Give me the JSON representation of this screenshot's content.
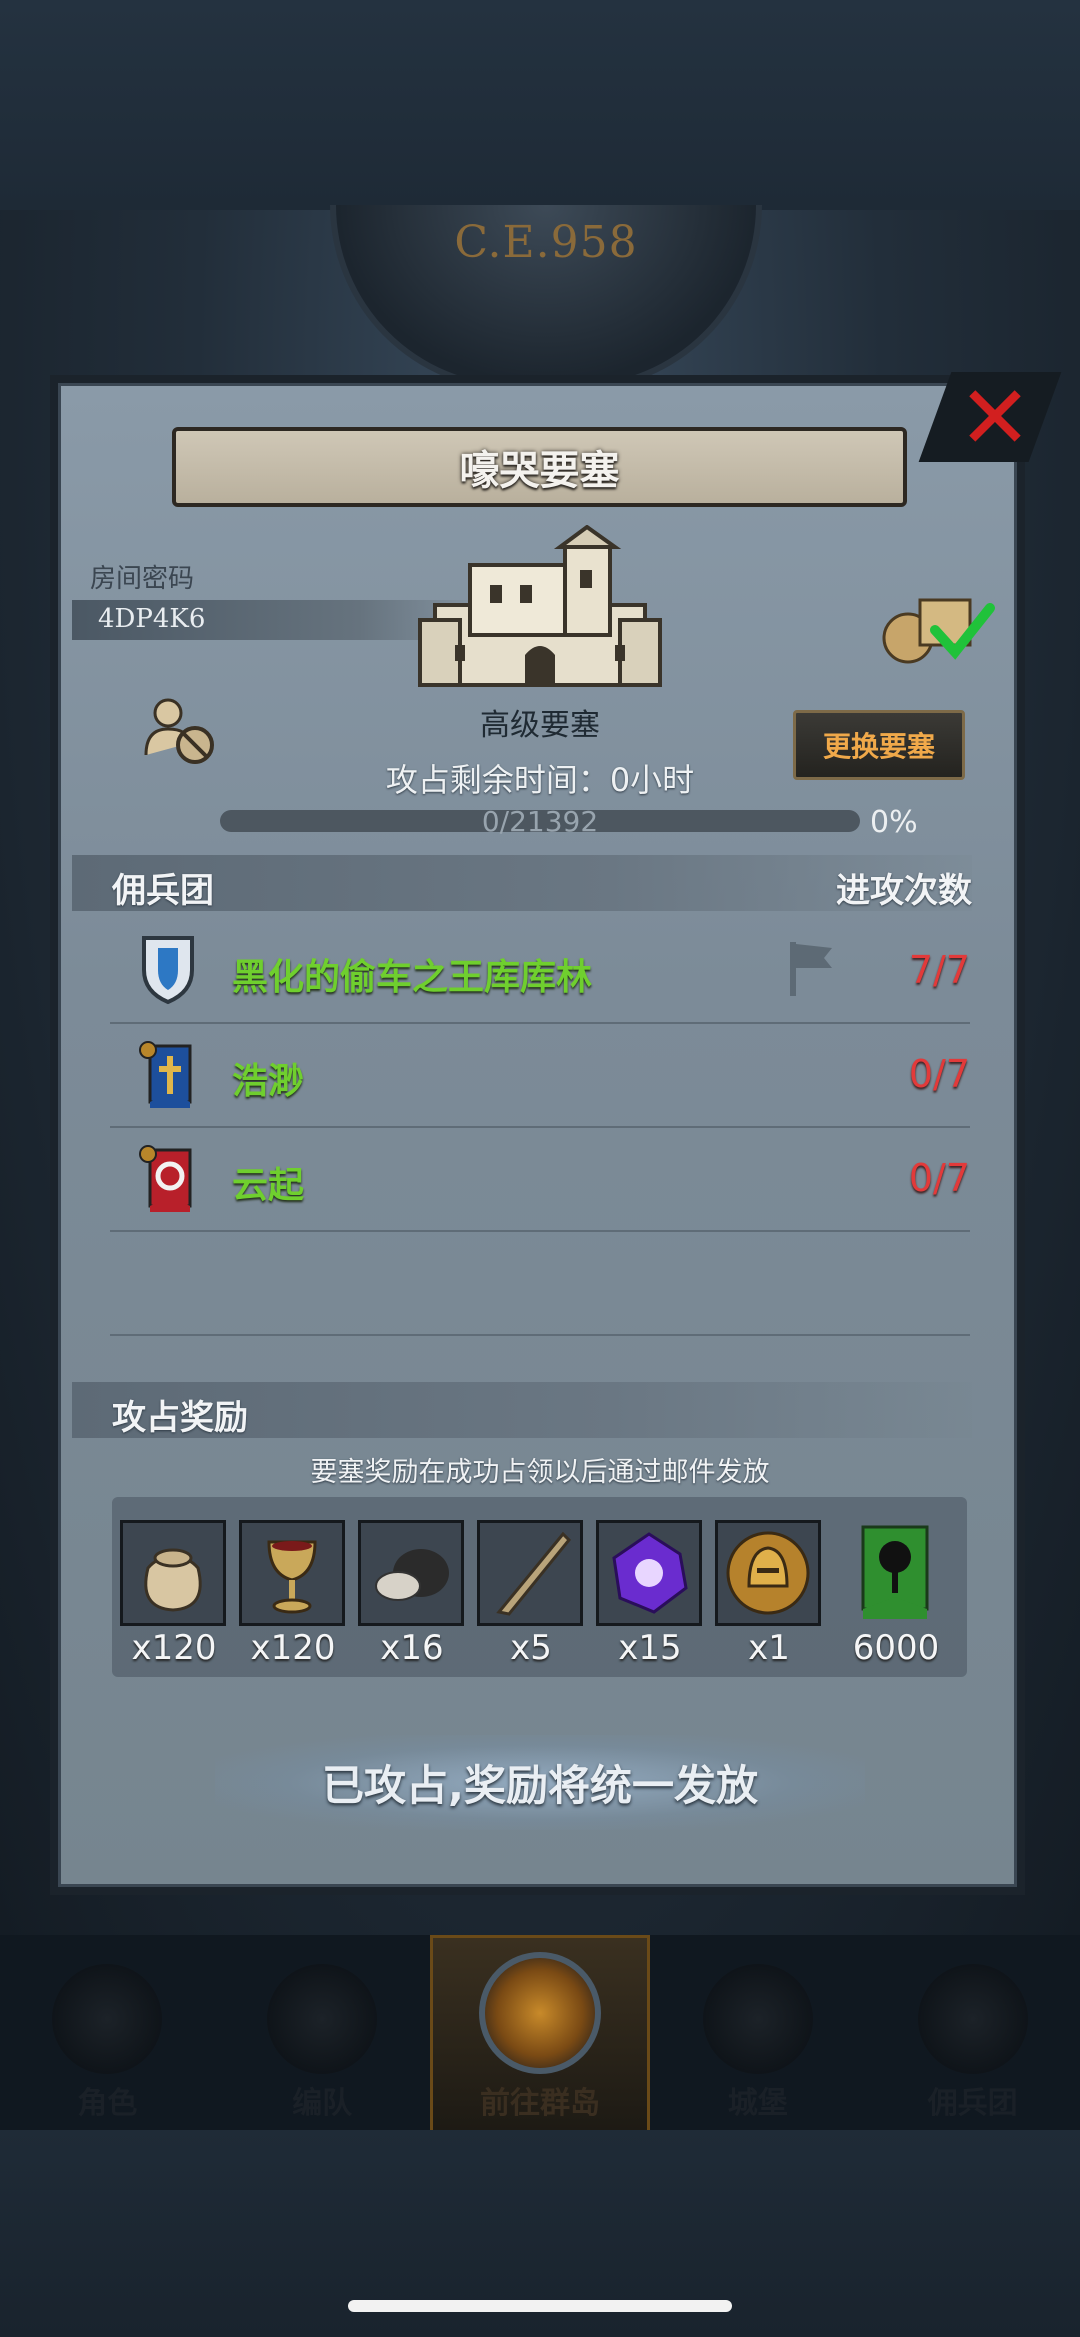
{
  "background": {
    "year_dial_text": "C.E.958"
  },
  "dialog": {
    "title": "嚎哭要塞",
    "room_label": "房间密码",
    "room_code": "4DP4K6",
    "fortress_name": "高级要塞",
    "time_left": "攻占剩余时间：0小时",
    "switch_button": "更换要塞",
    "progress": {
      "text": "0/21392",
      "percent_label": "0%",
      "fraction": 0
    },
    "mercenaries": {
      "header_left": "佣兵团",
      "header_right": "进攻次数",
      "rows": [
        {
          "name": "黑化的偷车之王库库林",
          "count": "7/7",
          "icon": "shield-emblem-icon",
          "flag": true
        },
        {
          "name": "浩渺",
          "count": "0/7",
          "icon": "blue-cross-banner-icon",
          "flag": false
        },
        {
          "name": "云起",
          "count": "0/7",
          "icon": "red-banner-icon",
          "flag": false
        }
      ]
    },
    "rewards": {
      "header": "攻占奖励",
      "note": "要塞奖励在成功占领以后通过邮件发放",
      "items": [
        {
          "icon": "coin-sack-icon",
          "qty": "x120"
        },
        {
          "icon": "wine-goblet-icon",
          "qty": "x120"
        },
        {
          "icon": "ore-chunk-icon",
          "qty": "x16"
        },
        {
          "icon": "horn-icon",
          "qty": "x5"
        },
        {
          "icon": "purple-crystal-icon",
          "qty": "x15"
        },
        {
          "icon": "golden-helmet-icon",
          "qty": "x1"
        },
        {
          "icon": "green-tree-banner-icon",
          "qty": "6000"
        }
      ]
    },
    "status_banner": "已攻占,奖励将统一发放"
  },
  "bottom_nav": {
    "tabs": [
      {
        "label": "角色",
        "icon": "knight-icon",
        "active": false
      },
      {
        "label": "编队",
        "icon": "helmet-icon",
        "active": false
      },
      {
        "label": "前往群岛",
        "icon": "islands-icon",
        "active": true
      },
      {
        "label": "城堡",
        "icon": "castle-icon",
        "active": false
      },
      {
        "label": "佣兵团",
        "icon": "mercenary-icon",
        "active": false
      }
    ]
  },
  "colors": {
    "accent_orange": "#f0a94a",
    "merc_name_green": "#6fcf2e",
    "count_red": "#e23a3a"
  }
}
